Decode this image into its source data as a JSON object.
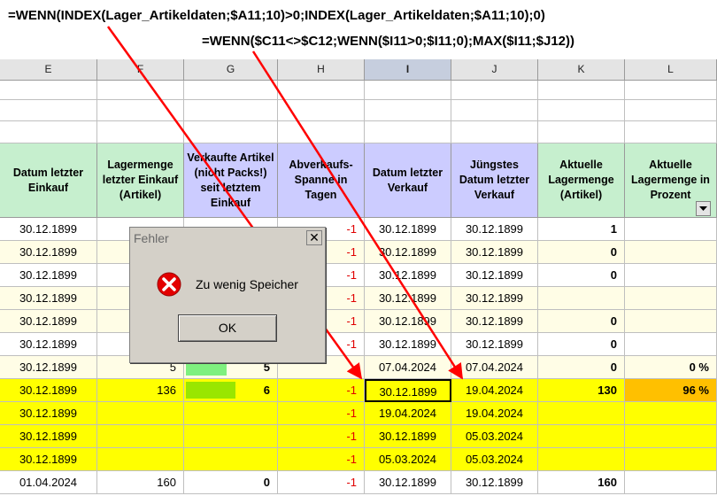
{
  "formula1": "=WENN(INDEX(Lager_Artikeldaten;$A11;10)>0;INDEX(Lager_Artikeldaten;$A11;10);0)",
  "formula2": "=WENN($C11<>$C12;WENN($I11>0;$I11;0);MAX($I11;$J12))",
  "columns": [
    "E",
    "F",
    "G",
    "H",
    "I",
    "J",
    "K",
    "L"
  ],
  "headers": [
    "Datum letzter Einkauf",
    "Lagermenge letzter Einkauf (Artikel)",
    "Verkaufte Artikel (nicht Packs!) seit letztem Einkauf",
    "Abverkaufs-Spanne in Tagen",
    "Datum letzter Verkauf",
    "Jüngstes Datum letzter Verkauf",
    "Aktuelle Lagermenge (Artikel)",
    "Aktuelle Lagermenge in Prozent"
  ],
  "rows": [
    [
      "30.12.1899",
      "",
      "",
      "-1",
      "30.12.1899",
      "30.12.1899",
      "1",
      ""
    ],
    [
      "30.12.1899",
      "",
      "",
      "-1",
      "30.12.1899",
      "30.12.1899",
      "0",
      ""
    ],
    [
      "30.12.1899",
      "",
      "",
      "-1",
      "30.12.1899",
      "30.12.1899",
      "0",
      ""
    ],
    [
      "30.12.1899",
      "",
      "",
      "-1",
      "30.12.1899",
      "30.12.1899",
      "",
      ""
    ],
    [
      "30.12.1899",
      "",
      "",
      "-1",
      "30.12.1899",
      "30.12.1899",
      "0",
      ""
    ],
    [
      "30.12.1899",
      "",
      "",
      "-1",
      "30.12.1899",
      "30.12.1899",
      "0",
      ""
    ],
    [
      "30.12.1899",
      "5",
      "5",
      "",
      "07.04.2024",
      "07.04.2024",
      "0",
      "0 %"
    ],
    [
      "30.12.1899",
      "136",
      "6",
      "-1",
      "30.12.1899",
      "19.04.2024",
      "130",
      "96 %"
    ],
    [
      "30.12.1899",
      "",
      "",
      "-1",
      "19.04.2024",
      "19.04.2024",
      "",
      ""
    ],
    [
      "30.12.1899",
      "",
      "",
      "-1",
      "30.12.1899",
      "05.03.2024",
      "",
      ""
    ],
    [
      "30.12.1899",
      "",
      "",
      "-1",
      "05.03.2024",
      "05.03.2024",
      "",
      ""
    ],
    [
      "01.04.2024",
      "160",
      "0",
      "-1",
      "30.12.1899",
      "30.12.1899",
      "160",
      ""
    ]
  ],
  "row_fills": [
    "#ffffff",
    "#fffde6",
    "#ffffff",
    "#fffde6",
    "#fffde6",
    "#ffffff",
    "#fffde6",
    "#ffff00",
    "#ffff00",
    "#ffff00",
    "#ffff00",
    "#ffffff"
  ],
  "bars": [
    {
      "row": 6,
      "fraction": 0.45,
      "color": "#7ff07f"
    },
    {
      "row": 7,
      "fraction": 0.55,
      "color": "#99e600"
    }
  ],
  "dialog": {
    "title": "Fehler",
    "close": "✕",
    "message": "Zu wenig Speicher",
    "ok": "OK",
    "icon": "error-icon"
  },
  "colors": {
    "header_green": "#c6efce",
    "header_purple": "#ccccff",
    "highlight_yellow": "#ffff00",
    "light_yellow": "#fffde6",
    "percent_orange": "#ffc000",
    "arrow_red": "#ff0000"
  }
}
